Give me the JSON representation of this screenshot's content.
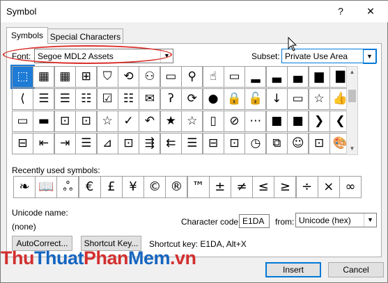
{
  "window": {
    "title": "Symbol",
    "help_label": "?",
    "close_label": "✕"
  },
  "tabs": [
    {
      "label": "Symbols"
    },
    {
      "label": "Special Characters"
    }
  ],
  "font": {
    "label": "Font:",
    "value": "Segoe MDL2 Assets"
  },
  "subset": {
    "label": "Subset:",
    "value": "Private Use Area"
  },
  "grid_rows": [
    [
      "⬚",
      "▦",
      "▦",
      "⊞",
      "⛉",
      "⟲",
      "⚇",
      "▭",
      "⚲",
      "☝",
      "▭",
      "▂",
      "▃",
      "▄",
      "▆"
    ],
    [
      "⟨",
      "☰",
      "☰",
      "☷",
      "☑",
      "☷",
      "✉",
      "ʔ",
      "⟳",
      "●",
      "🔒",
      "🔓",
      "↓",
      "▭",
      "☆"
    ],
    [
      "▭",
      "▬",
      "⊡",
      "⊡",
      "☆",
      "✓",
      "↶",
      "★",
      "☆",
      "▯",
      "⊘",
      "⋯",
      "■",
      "■",
      "❯"
    ],
    [
      "⊟",
      "⇤",
      "⇥",
      "☰",
      "⊿",
      "⊡",
      "⇶",
      "⇇",
      "☰",
      "⊟",
      "⊡",
      "◷",
      "⧉",
      "☺",
      "⊡"
    ]
  ],
  "grid_extra": {
    "row0_last": "▇",
    "row1_last": "👍",
    "row2_last": "❮",
    "row3_last": "🎨"
  },
  "recent": {
    "label": "Recently used symbols:",
    "symbols": [
      "❧",
      "📖",
      "ஃ",
      "€",
      "£",
      "¥",
      "©",
      "®",
      "™",
      "±",
      "≠",
      "≤",
      "≥",
      "÷",
      "×",
      "∞"
    ]
  },
  "unicode": {
    "label": "Unicode name:",
    "value": "(none)"
  },
  "char_code": {
    "label": "Character code:",
    "value": "E1DA"
  },
  "from": {
    "label": "from:",
    "value": "Unicode (hex)"
  },
  "buttons": {
    "autocorrect": "AutoCorrect...",
    "shortcut_key": "Shortcut Key...",
    "insert": "Insert",
    "cancel": "Cancel"
  },
  "shortcut_text": "Shortcut key: E1DA, Alt+X",
  "watermark": {
    "part1": "Thu",
    "part2": "Thuat",
    "part3": "Phan",
    "part4": "Mem",
    "part5": ".vn"
  },
  "colors": {
    "selected": "#1e7bd6",
    "annotation": "#d9312c",
    "watermark_red": "#d32f2f",
    "watermark_blue": "#1565c0"
  }
}
